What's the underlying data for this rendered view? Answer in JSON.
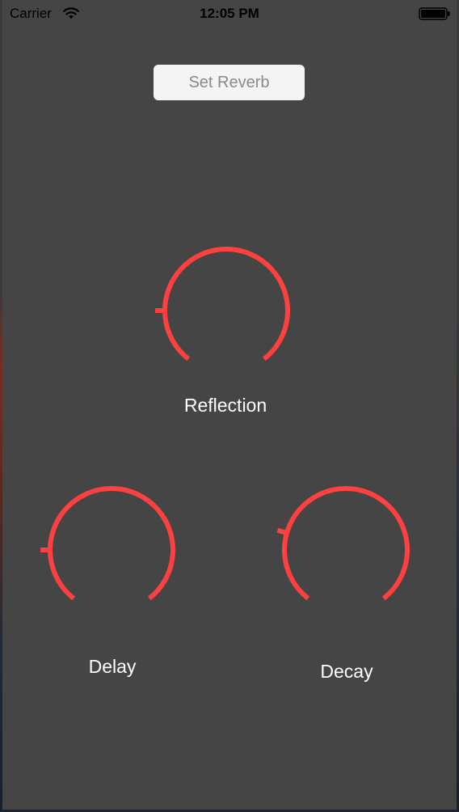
{
  "status_bar": {
    "carrier": "Carrier",
    "time": "12:05 PM",
    "wifi_icon": "wifi-icon",
    "battery_icon": "battery-icon"
  },
  "toolbar": {
    "set_reverb_label": "Set Reverb"
  },
  "knobs": {
    "reflection": {
      "label": "Reflection",
      "indicator_angle_deg": 180
    },
    "delay": {
      "label": "Delay",
      "indicator_angle_deg": 180
    },
    "decay": {
      "label": "Decay",
      "indicator_angle_deg": 196
    }
  },
  "colors": {
    "background": "#454545",
    "knob_accent": "#ff4040",
    "button_background": "#f4f4f4",
    "button_text": "#8a8a8a",
    "label_text": "#ffffff"
  }
}
